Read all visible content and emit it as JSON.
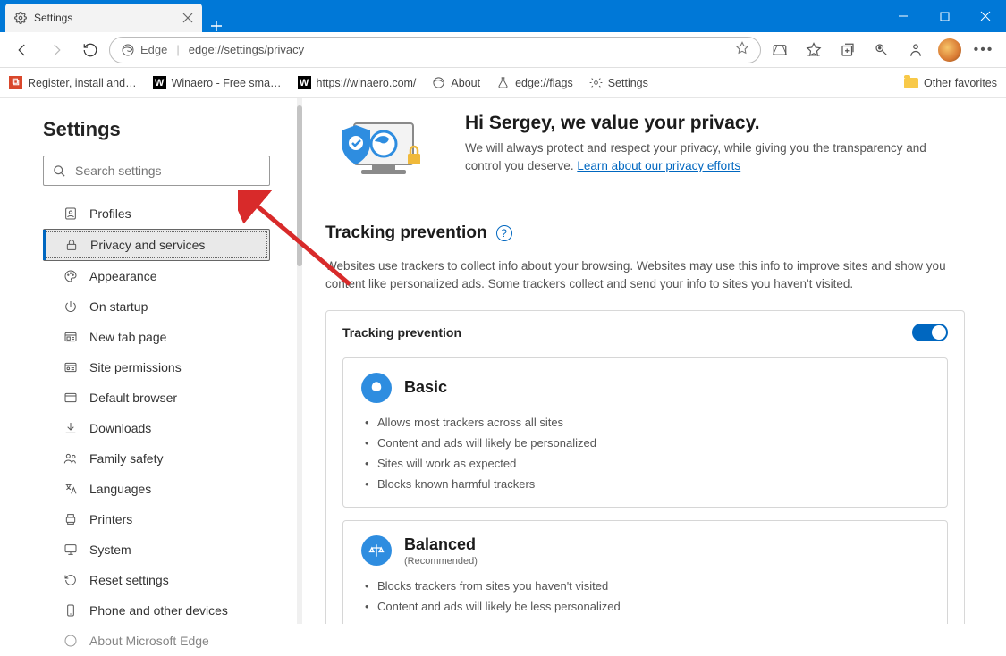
{
  "tab": {
    "title": "Settings"
  },
  "address": {
    "site_id": "Edge",
    "url": "edge://settings/privacy"
  },
  "bookmarks": {
    "b1": "Register, install and…",
    "b2": "Winaero - Free sma…",
    "b3": "https://winaero.com/",
    "b4": "About",
    "b5": "edge://flags",
    "b6": "Settings",
    "other": "Other favorites"
  },
  "sidebar": {
    "title": "Settings",
    "search_placeholder": "Search settings",
    "items": [
      "Profiles",
      "Privacy and services",
      "Appearance",
      "On startup",
      "New tab page",
      "Site permissions",
      "Default browser",
      "Downloads",
      "Family safety",
      "Languages",
      "Printers",
      "System",
      "Reset settings",
      "Phone and other devices",
      "About Microsoft Edge"
    ]
  },
  "hero": {
    "title": "Hi Sergey, we value your privacy.",
    "body": "We will always protect and respect your privacy, while giving you the transparency and control you deserve. ",
    "link": "Learn about our privacy efforts"
  },
  "tracking": {
    "heading": "Tracking prevention",
    "help": "?",
    "desc": "Websites use trackers to collect info about your browsing. Websites may use this info to improve sites and show you content like personalized ads. Some trackers collect and send your info to sites you haven't visited.",
    "card_title": "Tracking prevention",
    "basic": {
      "title": "Basic",
      "li1": "Allows most trackers across all sites",
      "li2": "Content and ads will likely be personalized",
      "li3": "Sites will work as expected",
      "li4": "Blocks known harmful trackers"
    },
    "balanced": {
      "title": "Balanced",
      "sub": "(Recommended)",
      "li1": "Blocks trackers from sites you haven't visited",
      "li2": "Content and ads will likely be less personalized"
    }
  }
}
